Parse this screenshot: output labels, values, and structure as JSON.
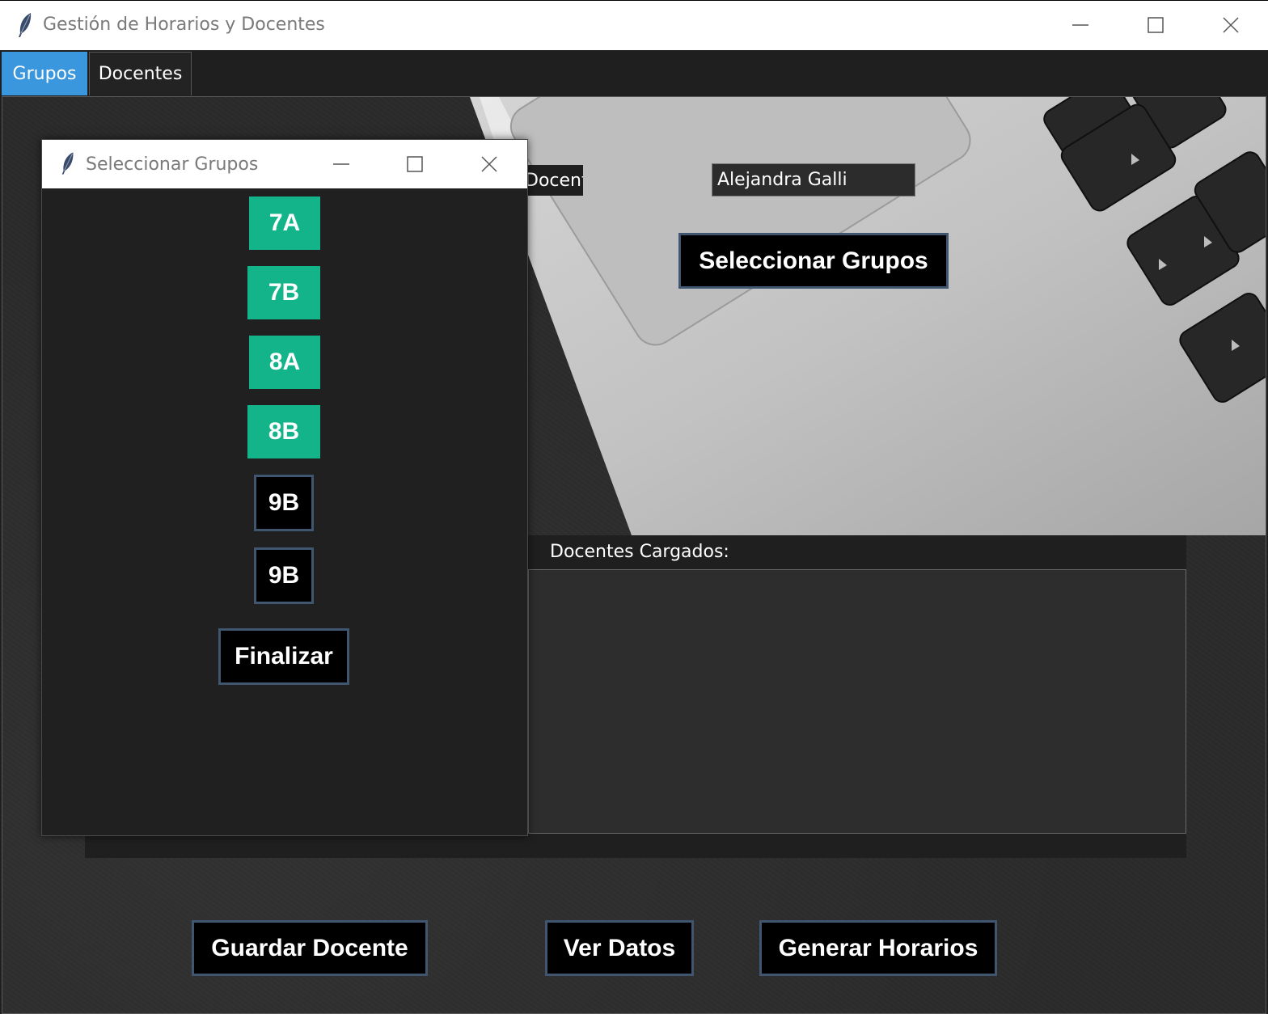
{
  "window": {
    "title": "Gestión de Horarios y Docentes"
  },
  "tabs": [
    {
      "label": "Grupos",
      "active": true
    },
    {
      "label": "Docentes",
      "active": false
    }
  ],
  "form": {
    "docente_label": "Docente",
    "docente_value": "Alejandra Galli",
    "select_groups_button": "Seleccionar Grupos"
  },
  "list": {
    "label": "Docentes Cargados:",
    "items": []
  },
  "actions": {
    "save_teacher": "Guardar Docente",
    "view_data": "Ver Datos",
    "generate_schedules": "Generar Horarios"
  },
  "dialog": {
    "title": "Seleccionar Grupos",
    "groups": [
      {
        "label": "7A",
        "selected": true
      },
      {
        "label": "7B",
        "selected": true
      },
      {
        "label": "8A",
        "selected": true
      },
      {
        "label": "8B",
        "selected": true
      },
      {
        "label": "9B",
        "selected": false
      },
      {
        "label": "9B",
        "selected": false
      }
    ],
    "finish_button": "Finalizar"
  },
  "colors": {
    "accent_tab": "#3a96dd",
    "selected_group": "#13b48a",
    "button_border": "#3f5570",
    "background": "#1e1e1e"
  },
  "icons": {
    "app": "feather-icon",
    "minimize": "minimize-icon",
    "maximize": "maximize-icon",
    "close": "close-icon"
  }
}
